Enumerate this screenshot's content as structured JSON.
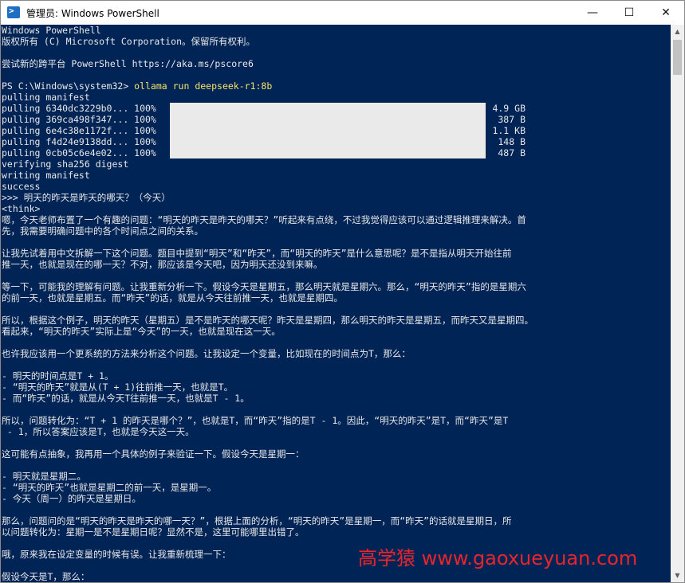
{
  "window": {
    "title": "管理员: Windows PowerShell",
    "icon": "powershell-icon",
    "buttons": {
      "minimize": "—",
      "maximize": "☐",
      "close": "✕"
    }
  },
  "terminal": {
    "lines": [
      "Windows PowerShell",
      "版权所有 (C) Microsoft Corporation。保留所有权利。",
      "",
      "尝试新的跨平台 PowerShell https://aka.ms/pscore6",
      "",
      "PS C:\\Windows\\system32> ",
      "pulling manifest"
    ],
    "prompt": "PS C:\\Windows\\system32> ",
    "command": "ollama run deepseek-r1:8b",
    "pulls": [
      {
        "label": "pulling 6340dc3229b0... 100%",
        "size": "4.9 GB",
        "progress": 1.0
      },
      {
        "label": "pulling 369ca498f347... 100%",
        "size": "387 B",
        "progress": 1.0
      },
      {
        "label": "pulling 6e4c38e1172f... 100%",
        "size": "1.1 KB",
        "progress": 1.0
      },
      {
        "label": "pulling f4d24e9138dd... 100%",
        "size": "148 B",
        "progress": 1.0
      },
      {
        "label": "pulling 0cb05c6e4e02... 100%",
        "size": "487 B",
        "progress": 1.0
      }
    ],
    "output": [
      "verifying sha256 digest",
      "writing manifest",
      "success",
      ">>> 明天的昨天是昨天的哪天？（今天）",
      "<think>",
      "嗯，今天老师布置了一个有趣的问题：“明天的昨天是昨天的哪天？”听起来有点绕，不过我觉得应该可以通过逻辑推理来解决。首",
      "先，我需要明确问题中的各个时间点之间的关系。",
      "",
      "让我先试着用中文拆解一下这个问题。题目中提到“明天”和“昨天”，而“明天的昨天”是什么意思呢？是不是指从明天开始往前",
      "推一天，也就是现在的哪一天？不对，那应该是今天吧，因为明天还没到来嘛。",
      "",
      "等一下，可能我的理解有问题。让我重新分析一下。假设今天是星期五，那么明天就是星期六。那么，“明天的昨天”指的是星期六",
      "的前一天，也就是星期五。而“昨天”的话，就是从今天往前推一天，也就是星期四。",
      "",
      "所以，根据这个例子，明天的昨天（星期五）是不是昨天的哪天呢？昨天是星期四，那么明天的昨天是星期五，而昨天又是星期四。",
      "看起来，“明天的昨天”实际上是“今天”的一天，也就是现在这一天。",
      "",
      "也许我应该用一个更系统的方法来分析这个问题。让我设定一个变量，比如现在的时间点为T，那么：",
      "",
      "- 明天的时间点是T + 1。",
      "- “明天的昨天”就是从(T + 1)往前推一天，也就是T。",
      "- 而“昨天”的话，就是从今天T往前推一天，也就是T - 1。",
      "",
      "所以，问题转化为：“T + 1 的昨天是哪个？”，也就是T，而“昨天”指的是T - 1。因此，“明天的昨天”是T，而“昨天”是T",
      " - 1，所以答案应该是T，也就是今天这一天。",
      "",
      "这可能有点抽象，我再用一个具体的例子来验证一下。假设今天是星期一：",
      "",
      "- 明天就是星期二。",
      "- “明天的昨天”也就是星期二的前一天，是星期一。",
      "- 今天（周一）的昨天是星期日。",
      "",
      "那么，问题问的是“明天的昨天是昨天的哪一天？”，根据上面的分析，“明天的昨天”是星期一，而“昨天”的话就是星期日，所",
      "以问题转化为：星期一是不是星期日呢？显然不是，这里可能哪里出错了。",
      "",
      "哦，原来我在设定变量的时候有误。让我重新梳理一下：",
      "",
      "假设今天是T，那么："
    ]
  },
  "watermark": "高学猿 www.gaoxueyuan.com",
  "colors": {
    "background": "#012456",
    "text": "#e8e8e8",
    "command": "#f5e663",
    "watermark": "#e8252b"
  }
}
